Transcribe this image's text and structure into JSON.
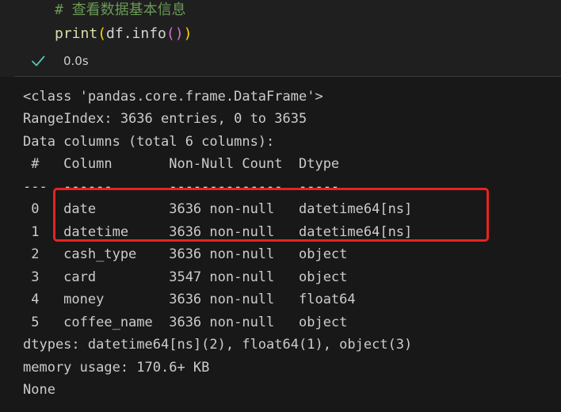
{
  "code": {
    "comment": "# 查看数据基本信息",
    "call_fn": "print",
    "call_open": "(",
    "call_arg": "df.info",
    "inner_parens": "()",
    "call_close": ")"
  },
  "status": {
    "icon": "check-icon",
    "elapsed": "0.0s",
    "icon_color": "#4ec9b0"
  },
  "output": {
    "lines": [
      "<class 'pandas.core.frame.DataFrame'>",
      "RangeIndex: 3636 entries, 0 to 3635",
      "Data columns (total 6 columns):",
      " #   Column       Non-Null Count  Dtype",
      "---  ------       --------------  -----",
      " 0   date         3636 non-null   datetime64[ns]",
      " 1   datetime     3636 non-null   datetime64[ns]",
      " 2   cash_type    3636 non-null   object",
      " 3   card         3547 non-null   object",
      " 4   money        3636 non-null   float64",
      " 5   coffee_name  3636 non-null   object",
      "dtypes: datetime64[ns](2), float64(1), object(3)",
      "memory usage: 170.6+ KB",
      "None"
    ]
  },
  "colors": {
    "highlight_border": "#e8231f",
    "comment": "#6a9955",
    "function": "#dcdcaa",
    "paren_outer": "#ffd700",
    "paren_inner": "#da70d6"
  }
}
